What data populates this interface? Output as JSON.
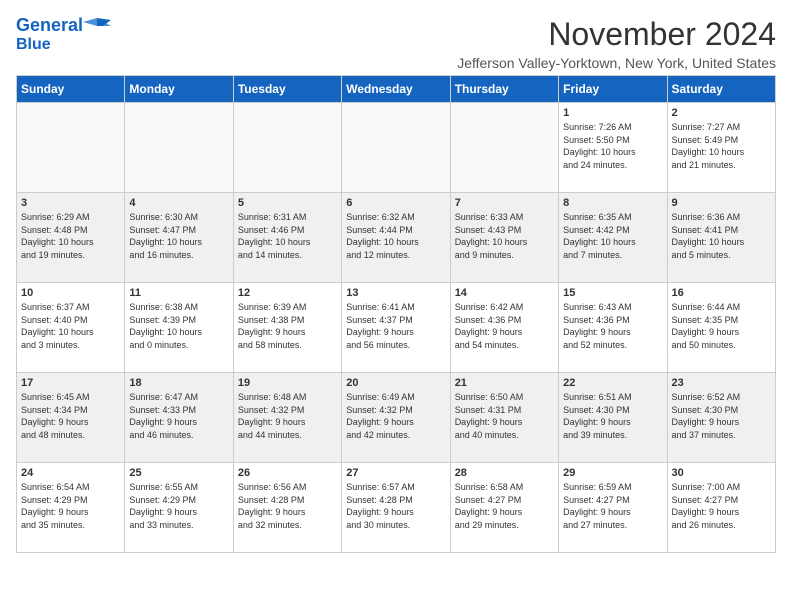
{
  "logo": {
    "line1": "General",
    "line2": "Blue"
  },
  "title": "November 2024",
  "subtitle": "Jefferson Valley-Yorktown, New York, United States",
  "weekdays": [
    "Sunday",
    "Monday",
    "Tuesday",
    "Wednesday",
    "Thursday",
    "Friday",
    "Saturday"
  ],
  "weeks": [
    [
      {
        "day": "",
        "info": ""
      },
      {
        "day": "",
        "info": ""
      },
      {
        "day": "",
        "info": ""
      },
      {
        "day": "",
        "info": ""
      },
      {
        "day": "",
        "info": ""
      },
      {
        "day": "1",
        "info": "Sunrise: 7:26 AM\nSunset: 5:50 PM\nDaylight: 10 hours\nand 24 minutes."
      },
      {
        "day": "2",
        "info": "Sunrise: 7:27 AM\nSunset: 5:49 PM\nDaylight: 10 hours\nand 21 minutes."
      }
    ],
    [
      {
        "day": "3",
        "info": "Sunrise: 6:29 AM\nSunset: 4:48 PM\nDaylight: 10 hours\nand 19 minutes."
      },
      {
        "day": "4",
        "info": "Sunrise: 6:30 AM\nSunset: 4:47 PM\nDaylight: 10 hours\nand 16 minutes."
      },
      {
        "day": "5",
        "info": "Sunrise: 6:31 AM\nSunset: 4:46 PM\nDaylight: 10 hours\nand 14 minutes."
      },
      {
        "day": "6",
        "info": "Sunrise: 6:32 AM\nSunset: 4:44 PM\nDaylight: 10 hours\nand 12 minutes."
      },
      {
        "day": "7",
        "info": "Sunrise: 6:33 AM\nSunset: 4:43 PM\nDaylight: 10 hours\nand 9 minutes."
      },
      {
        "day": "8",
        "info": "Sunrise: 6:35 AM\nSunset: 4:42 PM\nDaylight: 10 hours\nand 7 minutes."
      },
      {
        "day": "9",
        "info": "Sunrise: 6:36 AM\nSunset: 4:41 PM\nDaylight: 10 hours\nand 5 minutes."
      }
    ],
    [
      {
        "day": "10",
        "info": "Sunrise: 6:37 AM\nSunset: 4:40 PM\nDaylight: 10 hours\nand 3 minutes."
      },
      {
        "day": "11",
        "info": "Sunrise: 6:38 AM\nSunset: 4:39 PM\nDaylight: 10 hours\nand 0 minutes."
      },
      {
        "day": "12",
        "info": "Sunrise: 6:39 AM\nSunset: 4:38 PM\nDaylight: 9 hours\nand 58 minutes."
      },
      {
        "day": "13",
        "info": "Sunrise: 6:41 AM\nSunset: 4:37 PM\nDaylight: 9 hours\nand 56 minutes."
      },
      {
        "day": "14",
        "info": "Sunrise: 6:42 AM\nSunset: 4:36 PM\nDaylight: 9 hours\nand 54 minutes."
      },
      {
        "day": "15",
        "info": "Sunrise: 6:43 AM\nSunset: 4:36 PM\nDaylight: 9 hours\nand 52 minutes."
      },
      {
        "day": "16",
        "info": "Sunrise: 6:44 AM\nSunset: 4:35 PM\nDaylight: 9 hours\nand 50 minutes."
      }
    ],
    [
      {
        "day": "17",
        "info": "Sunrise: 6:45 AM\nSunset: 4:34 PM\nDaylight: 9 hours\nand 48 minutes."
      },
      {
        "day": "18",
        "info": "Sunrise: 6:47 AM\nSunset: 4:33 PM\nDaylight: 9 hours\nand 46 minutes."
      },
      {
        "day": "19",
        "info": "Sunrise: 6:48 AM\nSunset: 4:32 PM\nDaylight: 9 hours\nand 44 minutes."
      },
      {
        "day": "20",
        "info": "Sunrise: 6:49 AM\nSunset: 4:32 PM\nDaylight: 9 hours\nand 42 minutes."
      },
      {
        "day": "21",
        "info": "Sunrise: 6:50 AM\nSunset: 4:31 PM\nDaylight: 9 hours\nand 40 minutes."
      },
      {
        "day": "22",
        "info": "Sunrise: 6:51 AM\nSunset: 4:30 PM\nDaylight: 9 hours\nand 39 minutes."
      },
      {
        "day": "23",
        "info": "Sunrise: 6:52 AM\nSunset: 4:30 PM\nDaylight: 9 hours\nand 37 minutes."
      }
    ],
    [
      {
        "day": "24",
        "info": "Sunrise: 6:54 AM\nSunset: 4:29 PM\nDaylight: 9 hours\nand 35 minutes."
      },
      {
        "day": "25",
        "info": "Sunrise: 6:55 AM\nSunset: 4:29 PM\nDaylight: 9 hours\nand 33 minutes."
      },
      {
        "day": "26",
        "info": "Sunrise: 6:56 AM\nSunset: 4:28 PM\nDaylight: 9 hours\nand 32 minutes."
      },
      {
        "day": "27",
        "info": "Sunrise: 6:57 AM\nSunset: 4:28 PM\nDaylight: 9 hours\nand 30 minutes."
      },
      {
        "day": "28",
        "info": "Sunrise: 6:58 AM\nSunset: 4:27 PM\nDaylight: 9 hours\nand 29 minutes."
      },
      {
        "day": "29",
        "info": "Sunrise: 6:59 AM\nSunset: 4:27 PM\nDaylight: 9 hours\nand 27 minutes."
      },
      {
        "day": "30",
        "info": "Sunrise: 7:00 AM\nSunset: 4:27 PM\nDaylight: 9 hours\nand 26 minutes."
      }
    ]
  ]
}
